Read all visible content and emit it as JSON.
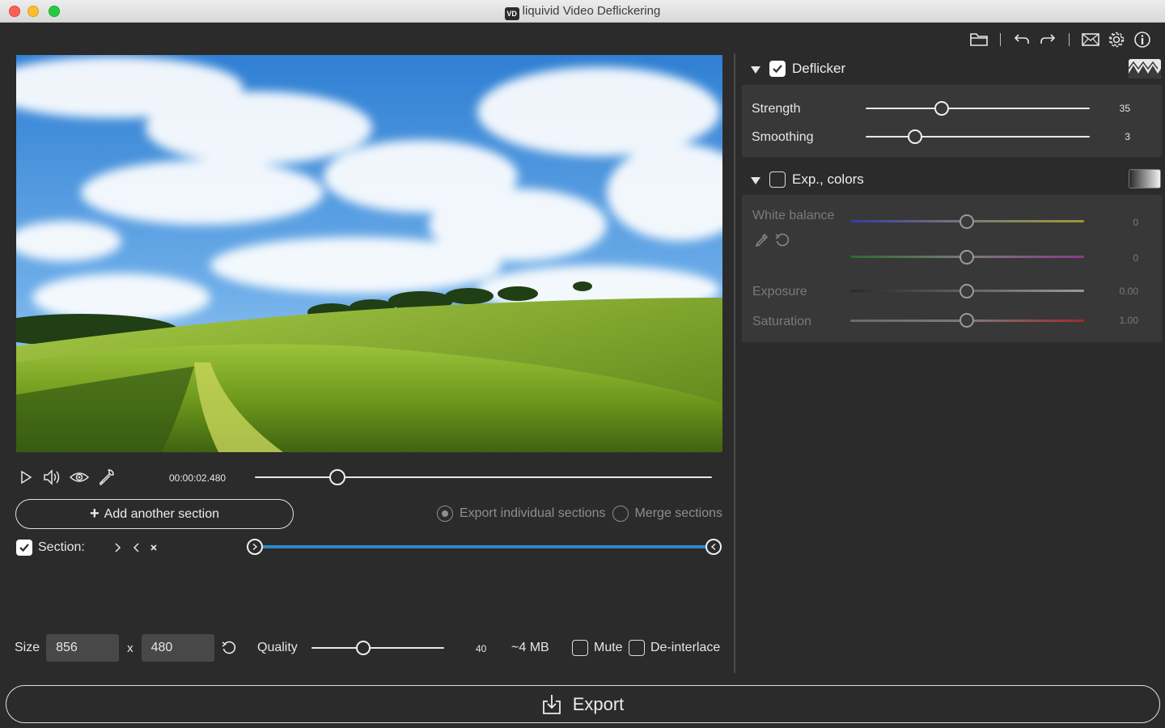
{
  "window": {
    "title": "liquivid Video Deflickering",
    "logo_text": "VD"
  },
  "toolbar": {
    "icons": [
      "folder-icon",
      "undo-icon",
      "redo-icon",
      "mail-icon",
      "gear-icon",
      "info-icon"
    ]
  },
  "playback": {
    "timecode": "00:00:02.480",
    "position": 0.18
  },
  "sections": {
    "add_label": "Add another section",
    "export_individual_label": "Export individual sections",
    "merge_label": "Merge sections",
    "selected_mode": "export_individual",
    "section_label": "Section:",
    "section_checked": true,
    "range_start": 0.0,
    "range_end": 1.0
  },
  "output": {
    "size_label": "Size",
    "width": "856",
    "x_label": "x",
    "height": "480",
    "quality_label": "Quality",
    "quality_value": "40",
    "quality_position": 0.39,
    "size_estimate": "~4 MB",
    "mute_label": "Mute",
    "mute_checked": false,
    "deinterlace_label": "De-interlace",
    "deinterlace_checked": false
  },
  "export": {
    "label": "Export"
  },
  "deflicker": {
    "title": "Deflicker",
    "enabled": true,
    "strength_label": "Strength",
    "strength_value": "35",
    "strength_position": 0.34,
    "smoothing_label": "Smoothing",
    "smoothing_value": "3",
    "smoothing_position": 0.22
  },
  "exp_colors": {
    "title": "Exp., colors",
    "enabled": false,
    "white_balance_label": "White balance",
    "wb_temp_value": "0",
    "wb_tint_value": "0",
    "exposure_label": "Exposure",
    "exposure_value": "0.00",
    "saturation_label": "Saturation",
    "saturation_value": "1.00"
  },
  "colors": {
    "accent": "#2d88c8",
    "background": "#2b2b2b",
    "panel": "#383838"
  }
}
